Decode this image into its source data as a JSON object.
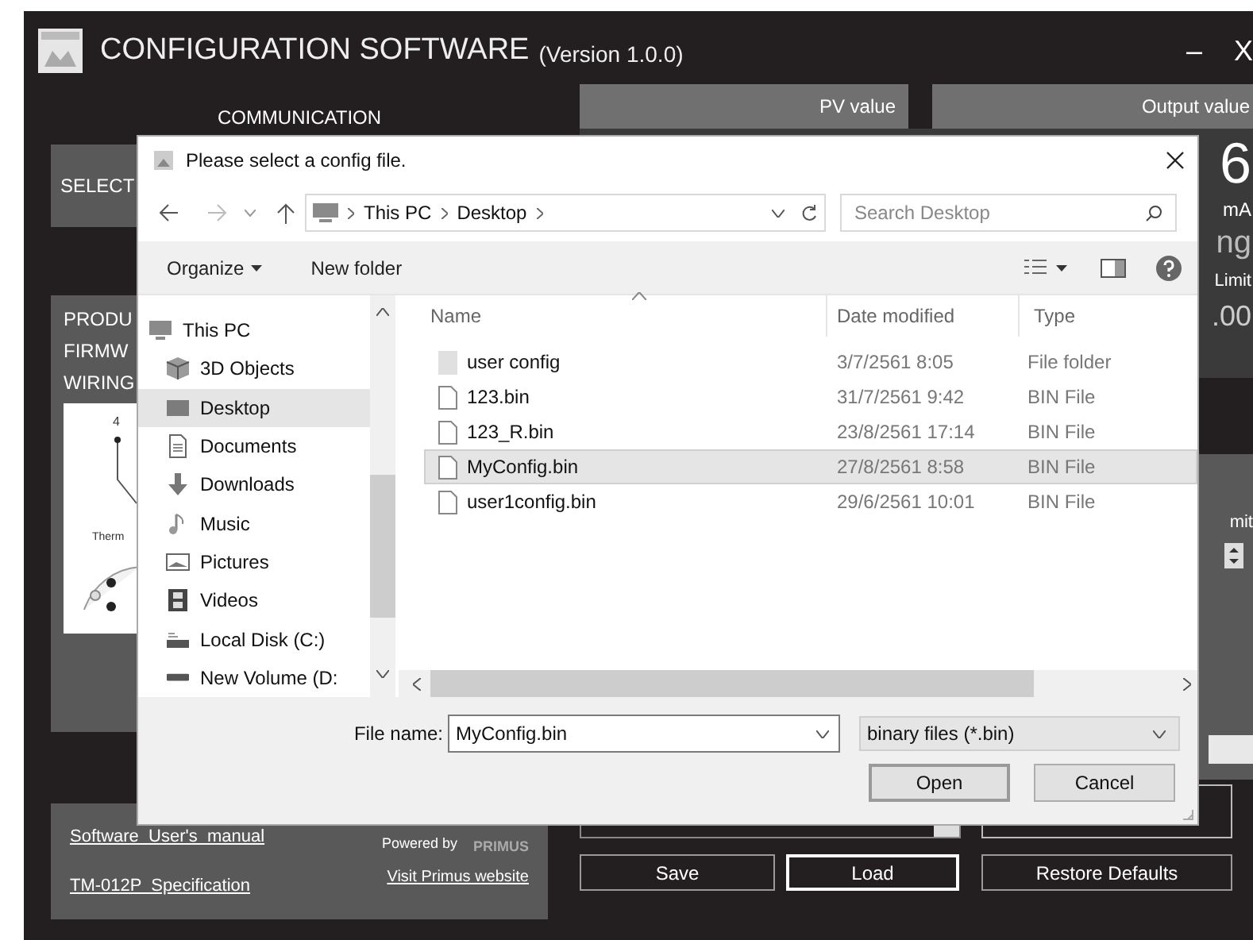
{
  "window": {
    "title": "CONFIGURATION SOFTWARE",
    "version": "(Version 1.0.0)",
    "minimize": "–",
    "close": "X"
  },
  "background": {
    "communication": "COMMUNICATION",
    "select": "SELECT",
    "product_labels": [
      "PRODU",
      "FIRMW",
      "WIRING"
    ],
    "wiring_labels": [
      "4",
      "Therm"
    ],
    "pv_label": "PV value",
    "output_label": "Output value",
    "output_digit": "6",
    "output_unit": "mA",
    "status_fragment": "ng",
    "limit_label": "Limit",
    "limit_value": ".00",
    "limit_label_2": "mit",
    "links": [
      "Software  User's  manual",
      "TM-012P  Specification"
    ],
    "powered_by": "Powered by",
    "brand": "PRIMUS",
    "website": "Visit Primus website",
    "buttons": [
      {
        "label": "Save",
        "focused": false
      },
      {
        "label": "Load",
        "focused": true
      },
      {
        "label": "Restore Defaults",
        "focused": false
      }
    ]
  },
  "dialog": {
    "title": "Please select a config file.",
    "breadcrumb": [
      "This PC",
      "Desktop"
    ],
    "search": {
      "placeholder": "Search Desktop"
    },
    "toolbar": [
      "Organize",
      "New folder"
    ],
    "nav_items": [
      {
        "label": "This PC",
        "kind": "pc",
        "selected": false
      },
      {
        "label": "3D Objects",
        "kind": "objects",
        "selected": false
      },
      {
        "label": "Desktop",
        "kind": "desktop",
        "selected": true
      },
      {
        "label": "Documents",
        "kind": "documents",
        "selected": false
      },
      {
        "label": "Downloads",
        "kind": "downloads",
        "selected": false
      },
      {
        "label": "Music",
        "kind": "music",
        "selected": false
      },
      {
        "label": "Pictures",
        "kind": "pictures",
        "selected": false
      },
      {
        "label": "Videos",
        "kind": "videos",
        "selected": false
      },
      {
        "label": "Local Disk (C:)",
        "kind": "disk",
        "selected": false
      },
      {
        "label": "New Volume (D:",
        "kind": "drive",
        "selected": false
      }
    ],
    "columns": [
      "Name",
      "Date modified",
      "Type"
    ],
    "files": [
      {
        "name": "user config",
        "date": "3/7/2561 8:05",
        "type": "File folder",
        "kind": "folder",
        "selected": false
      },
      {
        "name": "123.bin",
        "date": "31/7/2561 9:42",
        "type": "BIN File",
        "kind": "file",
        "selected": false
      },
      {
        "name": "123_R.bin",
        "date": "23/8/2561 17:14",
        "type": "BIN File",
        "kind": "file",
        "selected": false
      },
      {
        "name": "MyConfig.bin",
        "date": "27/8/2561 8:58",
        "type": "BIN File",
        "kind": "file",
        "selected": true
      },
      {
        "name": "user1config.bin",
        "date": "29/6/2561 10:01",
        "type": "BIN File",
        "kind": "file",
        "selected": false
      }
    ],
    "file_name_label": "File name:",
    "file_name": "MyConfig.bin",
    "filter": "binary files (*.bin)",
    "buttons": [
      "Open",
      "Cancel"
    ]
  }
}
